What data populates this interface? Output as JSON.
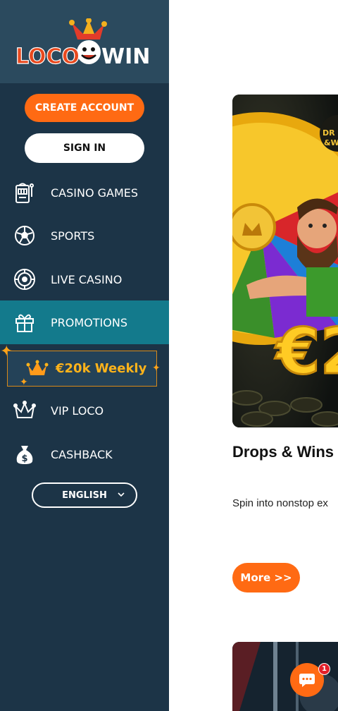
{
  "brand": {
    "logo_text_left": "LOCO",
    "logo_text_right": "WIN"
  },
  "auth": {
    "create_account": "CREATE ACCOUNT",
    "sign_in": "SIGN IN"
  },
  "nav": {
    "items": [
      {
        "label": "CASINO GAMES",
        "icon": "slot-machine-icon"
      },
      {
        "label": "SPORTS",
        "icon": "soccer-ball-icon"
      },
      {
        "label": "LIVE CASINO",
        "icon": "roulette-icon"
      },
      {
        "label": "PROMOTIONS",
        "icon": "gift-icon",
        "active": true
      },
      {
        "label": "VIP LOCO",
        "icon": "jester-crown-icon"
      },
      {
        "label": "CASHBACK",
        "icon": "money-bag-icon"
      }
    ],
    "promo_banner": "€20k Weekly"
  },
  "language": {
    "selected": "ENGLISH"
  },
  "promo_card": {
    "title": "Drops & Wins",
    "description": "Spin into nonstop ex",
    "more_label": "More >>",
    "image_text": "€2"
  },
  "chat": {
    "badge_count": "1"
  },
  "colors": {
    "accent": "#ff6a13",
    "sidebar": "#1c3447",
    "active": "#137a8c",
    "gold": "#ffb31a"
  }
}
